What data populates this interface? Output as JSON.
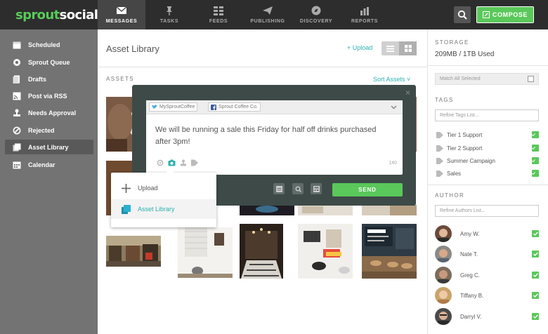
{
  "app": {
    "logo_sprout": "sprout",
    "logo_social": "social"
  },
  "nav": [
    {
      "label": "MESSAGES",
      "icon": "envelope-icon",
      "active": true
    },
    {
      "label": "TASKS",
      "icon": "pin-icon",
      "active": false
    },
    {
      "label": "FEEDS",
      "icon": "feeds-icon",
      "active": false
    },
    {
      "label": "PUBLISHING",
      "icon": "paper-plane-icon",
      "active": false
    },
    {
      "label": "DISCOVERY",
      "icon": "compass-icon",
      "active": false
    },
    {
      "label": "REPORTS",
      "icon": "bar-chart-icon",
      "active": false
    }
  ],
  "header": {
    "compose_label": "COMPOSE"
  },
  "sidebar": {
    "items": [
      {
        "label": "Scheduled",
        "icon": "calendar-31-icon"
      },
      {
        "label": "Sprout Queue",
        "icon": "queue-icon"
      },
      {
        "label": "Drafts",
        "icon": "drafts-icon"
      },
      {
        "label": "Post via RSS",
        "icon": "rss-icon"
      },
      {
        "label": "Needs Approval",
        "icon": "approval-stamp-icon"
      },
      {
        "label": "Rejected",
        "icon": "rejected-icon"
      },
      {
        "label": "Asset Library",
        "icon": "asset-library-icon",
        "active": true
      },
      {
        "label": "Calendar",
        "icon": "calendar-icon"
      }
    ]
  },
  "main": {
    "title": "Asset Library",
    "upload_label": "+ Upload",
    "assets_label": "ASSETS",
    "sort_label": "Sort Assets"
  },
  "right_panel": {
    "storage_label": "STORAGE",
    "storage_value": "209MB / 1TB Used",
    "match_all": "Match All Selected",
    "tags_label": "TAGS",
    "tags_placeholder": "Refine Tags List...",
    "tags": [
      "Tier 1 Support",
      "Tier 2 Support",
      "Summer Campaign",
      "Sales"
    ],
    "author_label": "AUTHOR",
    "author_placeholder": "Refine Authors List...",
    "authors": [
      "Amy W.",
      "Nate T.",
      "Greg C.",
      "Tiffany B.",
      "Darryl V."
    ]
  },
  "compose": {
    "profiles": [
      "MySproutCoffee",
      "Sprout Coffee Co."
    ],
    "message": "We will be running a sale this Friday for half off drinks purchased after 3pm!",
    "char_count": "140",
    "send_label": "SEND"
  },
  "dropdown": {
    "items": [
      "Upload",
      "Asset Library"
    ]
  },
  "colors": {
    "brand_green": "#59cb59",
    "link_teal": "#2bb0b0",
    "dark_bar": "#2d2d2d",
    "sidebar_gray": "#737373"
  }
}
